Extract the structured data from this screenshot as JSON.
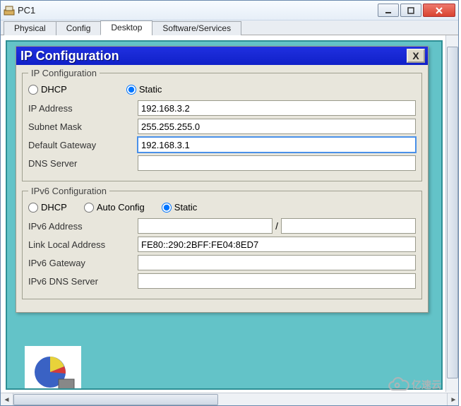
{
  "window": {
    "title": "PC1",
    "tabs": [
      "Physical",
      "Config",
      "Desktop",
      "Software/Services"
    ],
    "active_tab": "Desktop"
  },
  "dialog": {
    "title": "IP Configuration",
    "close_label": "X"
  },
  "ipv4": {
    "legend": "IP Configuration",
    "mode": {
      "dhcp": "DHCP",
      "static": "Static",
      "selected": "static"
    },
    "fields": {
      "ip_label": "IP Address",
      "ip_value": "192.168.3.2",
      "mask_label": "Subnet Mask",
      "mask_value": "255.255.255.0",
      "gw_label": "Default Gateway",
      "gw_value": "192.168.3.1",
      "dns_label": "DNS Server",
      "dns_value": ""
    }
  },
  "ipv6": {
    "legend": "IPv6 Configuration",
    "mode": {
      "dhcp": "DHCP",
      "auto": "Auto Config",
      "static": "Static",
      "selected": "static"
    },
    "fields": {
      "addr_label": "IPv6 Address",
      "addr_value": "",
      "prefix_value": "",
      "link_label": "Link Local Address",
      "link_value": "FE80::290:2BFF:FE04:8ED7",
      "gw_label": "IPv6 Gateway",
      "gw_value": "",
      "dns_label": "IPv6 DNS Server",
      "dns_value": ""
    }
  },
  "watermark": "亿速云"
}
